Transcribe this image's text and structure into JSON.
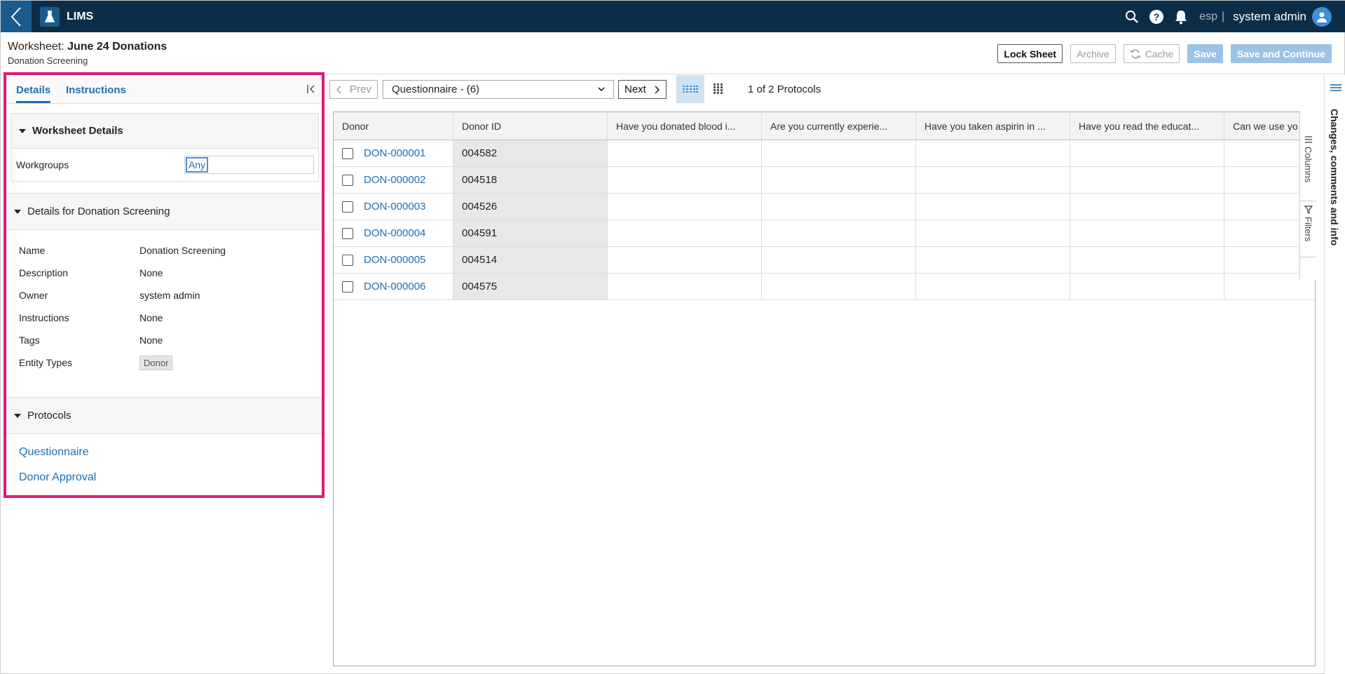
{
  "topbar": {
    "app_name": "LIMS",
    "lang": "esp",
    "separator": "|",
    "user": "system admin"
  },
  "header": {
    "title_prefix": "Worksheet: ",
    "title_name": "June 24 Donations",
    "subtitle": "Donation Screening",
    "buttons": {
      "lock": "Lock Sheet",
      "archive": "Archive",
      "cache": "Cache",
      "save": "Save",
      "save_continue": "Save and Continue"
    }
  },
  "left_panel": {
    "tabs": {
      "details": "Details",
      "instructions": "Instructions"
    },
    "worksheet_details": {
      "heading": "Worksheet Details",
      "workgroups_label": "Workgroups",
      "workgroups_value": "Any"
    },
    "details_for": {
      "heading": "Details for Donation Screening",
      "rows": [
        {
          "k": "Name",
          "v": "Donation Screening"
        },
        {
          "k": "Description",
          "v": "None"
        },
        {
          "k": "Owner",
          "v": "system admin"
        },
        {
          "k": "Instructions",
          "v": "None"
        },
        {
          "k": "Tags",
          "v": "None"
        }
      ],
      "entity_types_label": "Entity Types",
      "entity_types_value": "Donor"
    },
    "protocols": {
      "heading": "Protocols",
      "items": [
        "Questionnaire",
        "Donor Approval"
      ]
    }
  },
  "toolbar": {
    "prev": "Prev",
    "protocol_select": "Questionnaire - (6)",
    "next": "Next",
    "protocol_count": "1 of 2 Protocols"
  },
  "grid": {
    "headers": [
      "Donor",
      "Donor ID",
      "Have you donated blood i...",
      "Are you currently experie...",
      "Have you taken aspirin in ...",
      "Have you read the educat...",
      "Can we use yo"
    ],
    "rows": [
      {
        "donor": "DON-000001",
        "id": "004582"
      },
      {
        "donor": "DON-000002",
        "id": "004518"
      },
      {
        "donor": "DON-000003",
        "id": "004526"
      },
      {
        "donor": "DON-000004",
        "id": "004591"
      },
      {
        "donor": "DON-000005",
        "id": "004514"
      },
      {
        "donor": "DON-000006",
        "id": "004575"
      }
    ]
  },
  "side_tabs": {
    "columns": "Columns",
    "filters": "Filters"
  },
  "right_bar": {
    "label": "Changes, comments and info"
  },
  "colors": {
    "topbar": "#0c2d48",
    "accent": "#1d6fb1",
    "highlight": "#e0197d",
    "primary_disabled": "#9cc2e4"
  }
}
